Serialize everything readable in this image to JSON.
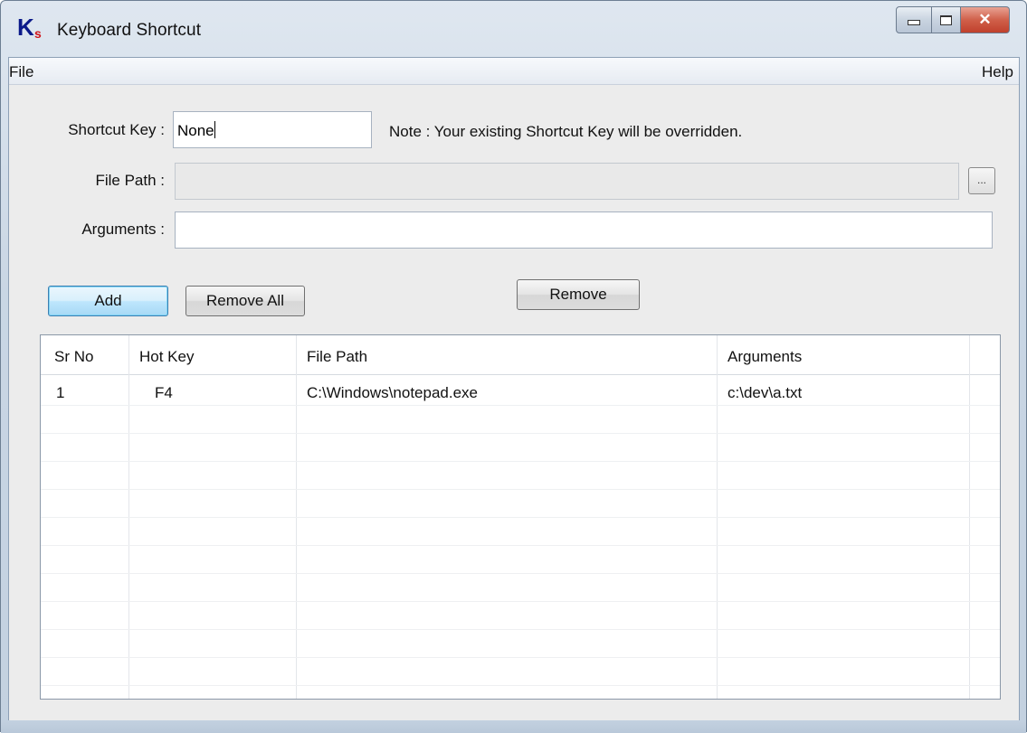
{
  "window": {
    "title": "Keyboard Shortcut",
    "icon_letter": "K",
    "icon_subscript": "s"
  },
  "menu": {
    "file": "File",
    "help": "Help"
  },
  "form": {
    "shortcut_key_label": "Shortcut Key :",
    "shortcut_key_value": "None",
    "note": "Note :  Your existing Shortcut Key will be overridden.",
    "file_path_label": "File Path :",
    "file_path_value": "",
    "browse_label": "...",
    "arguments_label": "Arguments :",
    "arguments_value": ""
  },
  "buttons": {
    "add": "Add",
    "remove_all": "Remove All",
    "remove": "Remove"
  },
  "table": {
    "columns": [
      "Sr No",
      "Hot Key",
      "File Path",
      "Arguments"
    ],
    "rows": [
      [
        "1",
        "F4",
        "C:\\Windows\\notepad.exe",
        "c:\\dev\\a.txt"
      ]
    ]
  }
}
